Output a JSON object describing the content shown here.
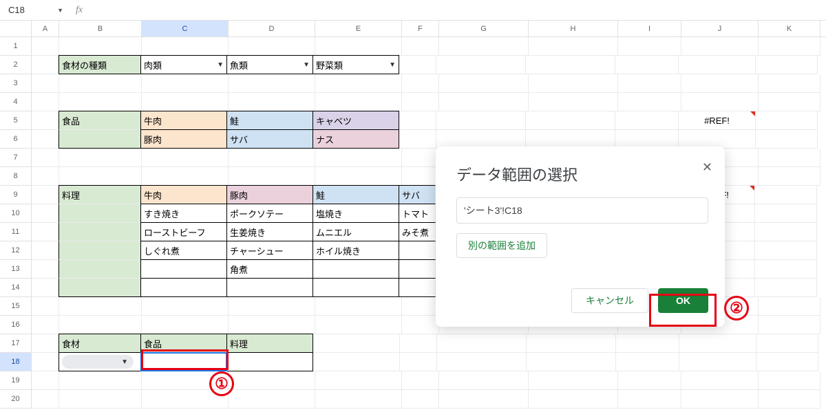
{
  "name_box": "C18",
  "fx_label": "fx",
  "columns": [
    "A",
    "B",
    "C",
    "D",
    "E",
    "F",
    "G",
    "H",
    "I",
    "J",
    "K"
  ],
  "active_col": "C",
  "active_row": 18,
  "row2": {
    "B": "食材の種類",
    "C": "肉類",
    "D": "魚類",
    "E": "野菜類"
  },
  "row5": {
    "B": "食品",
    "C": "牛肉",
    "D": "鮭",
    "E": "キャベツ"
  },
  "row6": {
    "C": "豚肉",
    "D": "サバ",
    "E": "ナス"
  },
  "row9": {
    "B": "料理",
    "C": "牛肉",
    "D": "豚肉",
    "E": "鮭",
    "F": "サバ"
  },
  "row10": {
    "C": "すき焼き",
    "D": "ポークソテー",
    "E": "塩焼き",
    "F": "トマト"
  },
  "row11": {
    "C": "ローストビーフ",
    "D": "生姜焼き",
    "E": "ムニエル",
    "F": "みそ煮"
  },
  "row12": {
    "C": "しぐれ煮",
    "D": "チャーシュー",
    "E": "ホイル焼き"
  },
  "row13": {
    "D": "角煮"
  },
  "row17": {
    "B": "食材",
    "C": "食品",
    "D": "料理"
  },
  "errors": {
    "J5": "#REF!",
    "J9": "#REF!"
  },
  "dialog": {
    "title": "データ範囲の選択",
    "input_value": "'シート3'!C18",
    "add_range": "別の範囲を追加",
    "cancel": "キャンセル",
    "ok": "OK"
  },
  "annotations": {
    "one": "①",
    "two": "②"
  }
}
